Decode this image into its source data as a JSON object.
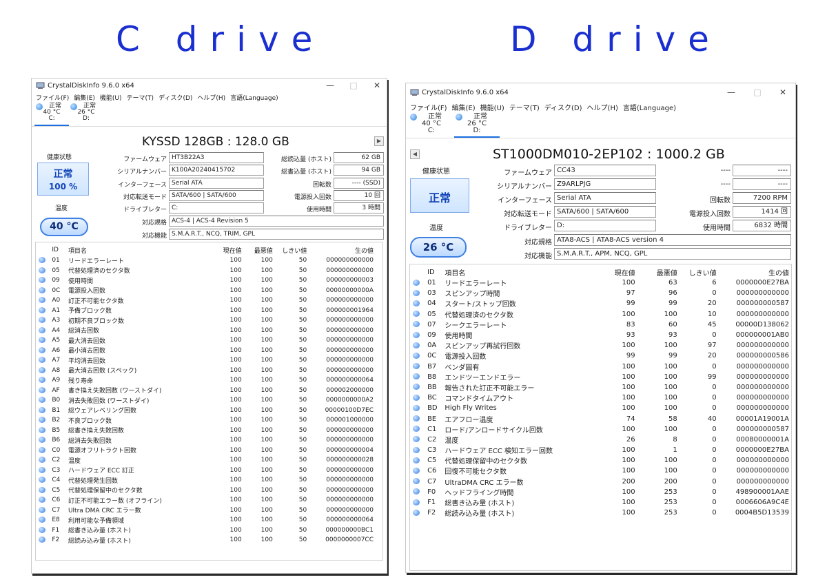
{
  "headings": {
    "c": "C drive",
    "d": "D drive"
  },
  "colors": {
    "heading": "#1a2fd0",
    "health_text": "#1245b8",
    "status_dot": "#2d79e6"
  },
  "common": {
    "app_title": "CrystalDiskInfo 9.6.0 x64",
    "menu": [
      "ファイル(F)",
      "編集(E)",
      "機能(U)",
      "テーマ(T)",
      "ディスク(D)",
      "ヘルプ(H)",
      "言語(Language)"
    ],
    "win_min": "—",
    "win_max": "□",
    "win_close": "✕",
    "drive_tabs": [
      {
        "status": "正常",
        "temp": "40 °C",
        "letter": "C:"
      },
      {
        "status": "正常",
        "temp": "26 °C",
        "letter": "D:"
      }
    ],
    "labels": {
      "health": "健康状態",
      "temperature": "温度",
      "firmware": "ファームウェア",
      "serial": "シリアルナンバー",
      "interface": "インターフェース",
      "transfer": "対応転送モード",
      "drive_letter": "ドライブレター",
      "standard": "対応規格",
      "features": "対応機能"
    },
    "columns": [
      "ID",
      "項目名",
      "現在値",
      "最悪値",
      "しきい値",
      "生の値"
    ]
  },
  "c": {
    "model": "KYSSD 128GB : 128.0 GB",
    "nav_next": "▶",
    "health_status": "正常",
    "health_pct": "100 %",
    "temp": "40 °C",
    "firmware": "HT3B22A3",
    "serial": "K100A20240415702",
    "interface": "Serial ATA",
    "transfer": "SATA/600 | SATA/600",
    "drive_letter": "C:",
    "standard": "ACS-4 | ACS-4 Revision 5",
    "features": "S.M.A.R.T., NCQ, TRIM, GPL",
    "right": [
      {
        "label": "総読込量 (ホスト)",
        "value": "62 GB"
      },
      {
        "label": "総書込量 (ホスト)",
        "value": "94 GB"
      },
      {
        "label": "回転数",
        "value": "---- (SSD)"
      },
      {
        "label": "電源投入回数",
        "value": "10 回"
      },
      {
        "label": "使用時間",
        "value": "3 時間"
      }
    ],
    "rows": [
      [
        "01",
        "リードエラーレート",
        "100",
        "100",
        "50",
        "000000000000"
      ],
      [
        "05",
        "代替処理済のセクタ数",
        "100",
        "100",
        "50",
        "000000000000"
      ],
      [
        "09",
        "使用時間",
        "100",
        "100",
        "50",
        "000000000003"
      ],
      [
        "0C",
        "電源投入回数",
        "100",
        "100",
        "50",
        "00000000000A"
      ],
      [
        "A0",
        "訂正不可能セクタ数",
        "100",
        "100",
        "50",
        "000000000000"
      ],
      [
        "A1",
        "予備ブロック数",
        "100",
        "100",
        "50",
        "000000001964"
      ],
      [
        "A3",
        "初期不良ブロック数",
        "100",
        "100",
        "50",
        "000000000000"
      ],
      [
        "A4",
        "総消去回数",
        "100",
        "100",
        "50",
        "000000000000"
      ],
      [
        "A5",
        "最大消去回数",
        "100",
        "100",
        "50",
        "000000000000"
      ],
      [
        "A6",
        "最小消去回数",
        "100",
        "100",
        "50",
        "000000000000"
      ],
      [
        "A7",
        "平均消去回数",
        "100",
        "100",
        "50",
        "000000000000"
      ],
      [
        "A8",
        "最大消去回数 (スペック)",
        "100",
        "100",
        "50",
        "000000000000"
      ],
      [
        "A9",
        "残り寿命",
        "100",
        "100",
        "50",
        "000000000064"
      ],
      [
        "AF",
        "書き換え失敗回数 (ワーストダイ)",
        "100",
        "100",
        "50",
        "000002000000"
      ],
      [
        "B0",
        "消去失敗回数 (ワーストダイ)",
        "100",
        "100",
        "50",
        "0000000000A2"
      ],
      [
        "B1",
        "総ウェアレベリング回数",
        "100",
        "100",
        "50",
        "00000100D7EC"
      ],
      [
        "B2",
        "不良ブロック数",
        "100",
        "100",
        "50",
        "000001000000"
      ],
      [
        "B5",
        "総書き換え失敗回数",
        "100",
        "100",
        "50",
        "000000000000"
      ],
      [
        "B6",
        "総消去失敗回数",
        "100",
        "100",
        "50",
        "000000000000"
      ],
      [
        "C0",
        "電源オフリトラクト回数",
        "100",
        "100",
        "50",
        "000000000004"
      ],
      [
        "C2",
        "温度",
        "100",
        "100",
        "50",
        "000000000028"
      ],
      [
        "C3",
        "ハードウェア ECC 訂正",
        "100",
        "100",
        "50",
        "000000000000"
      ],
      [
        "C4",
        "代替処理発生回数",
        "100",
        "100",
        "50",
        "000000000000"
      ],
      [
        "C5",
        "代替処理保留中のセクタ数",
        "100",
        "100",
        "50",
        "000000000000"
      ],
      [
        "C6",
        "訂正不可能エラー数 (オフライン)",
        "100",
        "100",
        "50",
        "000000000000"
      ],
      [
        "C7",
        "Ultra DMA CRC エラー数",
        "100",
        "100",
        "50",
        "000000000000"
      ],
      [
        "E8",
        "利用可能な予備領域",
        "100",
        "100",
        "50",
        "000000000064"
      ],
      [
        "F1",
        "総書き込み量 (ホスト)",
        "100",
        "100",
        "50",
        "000000000BC1"
      ],
      [
        "F2",
        "総読み込み量 (ホスト)",
        "100",
        "100",
        "50",
        "0000000007CC"
      ]
    ]
  },
  "d": {
    "model": "ST1000DM010-2EP102 : 1000.2 GB",
    "nav_prev": "◀",
    "health_status": "正常",
    "temp": "26 °C",
    "firmware": "CC43",
    "serial": "Z9ARLPJG",
    "interface": "Serial ATA",
    "transfer": "SATA/600 | SATA/600",
    "drive_letter": "D:",
    "standard": "ATA8-ACS | ATA8-ACS version 4",
    "features": "S.M.A.R.T., APM, NCQ, GPL",
    "right": [
      {
        "label": "----",
        "value": "----"
      },
      {
        "label": "----",
        "value": "----"
      },
      {
        "label": "回転数",
        "value": "7200 RPM"
      },
      {
        "label": "電源投入回数",
        "value": "1414 回"
      },
      {
        "label": "使用時間",
        "value": "6832 時間"
      }
    ],
    "rows": [
      [
        "01",
        "リードエラーレート",
        "100",
        "63",
        "6",
        "0000000E27BA"
      ],
      [
        "03",
        "スピンアップ時間",
        "97",
        "96",
        "0",
        "000000000000"
      ],
      [
        "04",
        "スタート/ストップ回数",
        "99",
        "99",
        "20",
        "000000000587"
      ],
      [
        "05",
        "代替処理済のセクタ数",
        "100",
        "100",
        "10",
        "000000000000"
      ],
      [
        "07",
        "シークエラーレート",
        "83",
        "60",
        "45",
        "00000D138062"
      ],
      [
        "09",
        "使用時間",
        "93",
        "93",
        "0",
        "000000001AB0"
      ],
      [
        "0A",
        "スピンアップ再試行回数",
        "100",
        "100",
        "97",
        "000000000000"
      ],
      [
        "0C",
        "電源投入回数",
        "99",
        "99",
        "20",
        "000000000586"
      ],
      [
        "B7",
        "ベンダ固有",
        "100",
        "100",
        "0",
        "000000000000"
      ],
      [
        "B8",
        "エンドツーエンドエラー",
        "100",
        "100",
        "99",
        "000000000000"
      ],
      [
        "BB",
        "報告された訂正不可能エラー",
        "100",
        "100",
        "0",
        "000000000000"
      ],
      [
        "BC",
        "コマンドタイムアウト",
        "100",
        "100",
        "0",
        "000000000000"
      ],
      [
        "BD",
        "High Fly Writes",
        "100",
        "100",
        "0",
        "000000000000"
      ],
      [
        "BE",
        "エアフロー温度",
        "74",
        "58",
        "40",
        "00001A19001A"
      ],
      [
        "C1",
        "ロード/アンロードサイクル回数",
        "100",
        "100",
        "0",
        "000000000587"
      ],
      [
        "C2",
        "温度",
        "26",
        "8",
        "0",
        "00080000001A"
      ],
      [
        "C3",
        "ハードウェア ECC 検知エラー回数",
        "100",
        "1",
        "0",
        "0000000E27BA"
      ],
      [
        "C5",
        "代替処理保留中のセクタ数",
        "100",
        "100",
        "0",
        "000000000000"
      ],
      [
        "C6",
        "回復不可能セクタ数",
        "100",
        "100",
        "0",
        "000000000000"
      ],
      [
        "C7",
        "UltraDMA CRC エラー数",
        "200",
        "200",
        "0",
        "000000000000"
      ],
      [
        "F0",
        "ヘッドフライング時間",
        "100",
        "253",
        "0",
        "498900001AAE"
      ],
      [
        "F1",
        "総書き込み量 (ホスト)",
        "100",
        "253",
        "0",
        "0006606A9C4E"
      ],
      [
        "F2",
        "総読み込み量 (ホスト)",
        "100",
        "253",
        "0",
        "0004B5D13539"
      ]
    ]
  }
}
